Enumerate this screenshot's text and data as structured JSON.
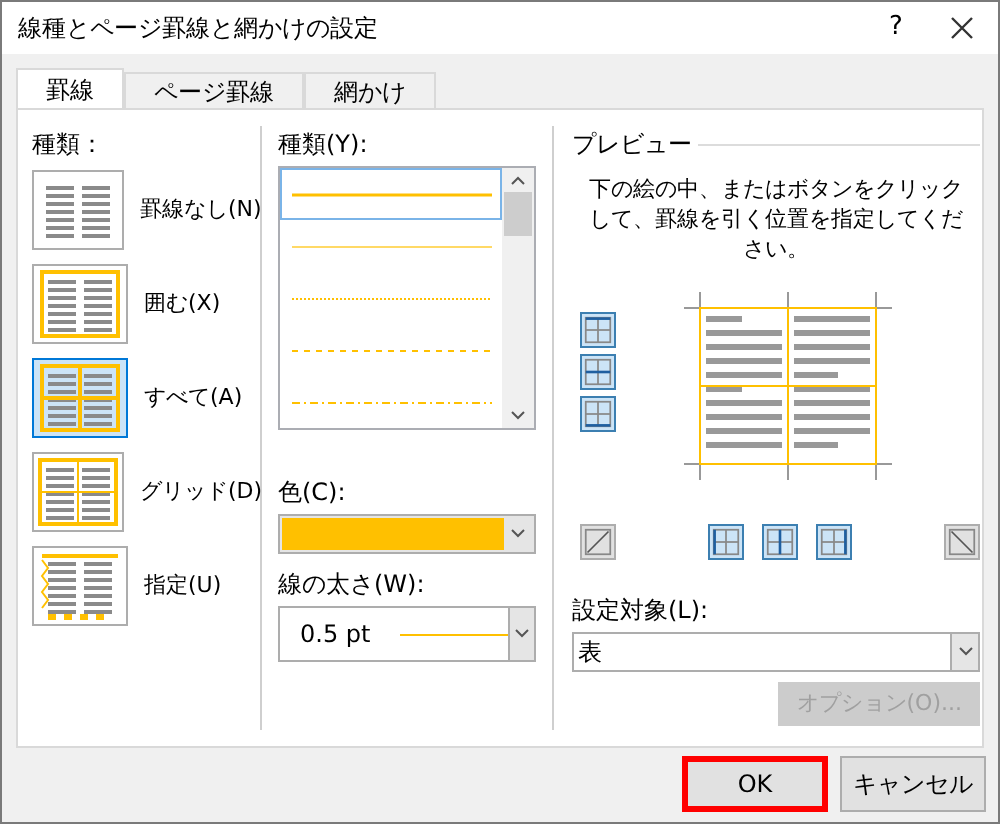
{
  "window": {
    "title": "線種とページ罫線と網かけの設定",
    "help": "?"
  },
  "tabs": [
    {
      "label": "罫線",
      "selected": true
    },
    {
      "label": "ページ罫線",
      "selected": false
    },
    {
      "label": "網かけ",
      "selected": false
    }
  ],
  "setting": {
    "label": "種類：",
    "items": [
      {
        "kind": "none",
        "label": "罫線なし(N)",
        "selected": false
      },
      {
        "kind": "box",
        "label": "囲む(X)",
        "selected": false
      },
      {
        "kind": "all",
        "label": "すべて(A)",
        "selected": true
      },
      {
        "kind": "grid",
        "label": "グリッド(D)",
        "selected": false
      },
      {
        "kind": "custom",
        "label": "指定(U)",
        "selected": false
      }
    ]
  },
  "style": {
    "label": "種類(Y):",
    "items": [
      {
        "kind": "solid",
        "selected": true
      },
      {
        "kind": "thin",
        "selected": false
      },
      {
        "kind": "dotted",
        "selected": false
      },
      {
        "kind": "dashed",
        "selected": false
      },
      {
        "kind": "dashdot",
        "selected": false
      }
    ]
  },
  "color": {
    "label": "色(C):",
    "color": "#ffc000"
  },
  "width": {
    "label": "線の太さ(W):",
    "value": "0.5 pt"
  },
  "preview": {
    "label": "プレビュー",
    "instructions": "下の絵の中、またはボタンをクリックして、罫線を引く位置を指定してください。",
    "side_buttons": [
      {
        "kind": "top",
        "pressed": true
      },
      {
        "kind": "middle",
        "pressed": true
      },
      {
        "kind": "bottom",
        "pressed": true
      }
    ],
    "bottom_buttons": [
      {
        "kind": "diag-up",
        "pressed": false
      },
      {
        "kind": "left",
        "pressed": true
      },
      {
        "kind": "center",
        "pressed": true
      },
      {
        "kind": "right",
        "pressed": true
      },
      {
        "kind": "diag-down",
        "pressed": false
      }
    ]
  },
  "apply_to": {
    "label": "設定対象(L):",
    "value": "表"
  },
  "options_button": {
    "label": "オプション(O)...",
    "disabled": true
  },
  "buttons": [
    {
      "label": "OK",
      "highlighted": true
    },
    {
      "label": "キャンセル",
      "highlighted": false
    }
  ]
}
